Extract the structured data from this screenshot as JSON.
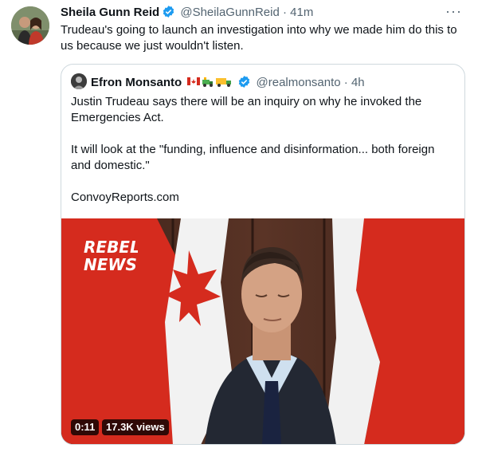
{
  "tweet": {
    "author_name": "Sheila Gunn Reid",
    "handle": "@SheilaGunnReid",
    "separator": "·",
    "time": "41m",
    "more_label": "···",
    "text": "Trudeau's going to launch an investigation into why we made him do this to us because we just wouldn't listen."
  },
  "quote": {
    "author_name": "Efron Monsanto",
    "handle": "@realmonsanto",
    "separator": "·",
    "time": "4h",
    "paragraphs": [
      "Justin Trudeau says there will be an inquiry on why he invoked the Emergencies Act.",
      "It will look at the \"funding, influence and disinformation... both foreign and domestic.\"",
      "ConvoyReports.com"
    ],
    "video": {
      "watermark_line1": "REBEL",
      "watermark_line2": "NEWS",
      "duration": "0:11",
      "views": "17.3K views"
    }
  },
  "colors": {
    "verified_blue": "#1d9bf0",
    "secondary_text": "#536471",
    "border": "#cfd9de",
    "flag_red": "#d52b1e"
  }
}
